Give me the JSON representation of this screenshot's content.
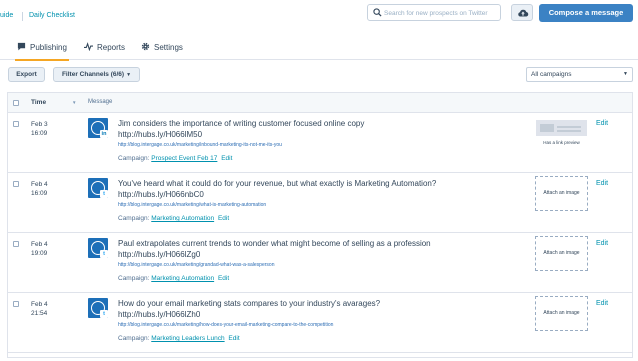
{
  "topbar": {
    "guide_link": "uide",
    "checklist_link": "Daily Checklist",
    "search_placeholder": "Search for new prospects on Twitter",
    "compose_label": "Compose a message",
    "icons": {
      "search": "search-icon",
      "cloud": "cloud-upload-icon"
    }
  },
  "tabs": [
    {
      "label": "Publishing",
      "icon": "speech-bubble-icon",
      "active": true
    },
    {
      "label": "Reports",
      "icon": "pulse-chart-icon",
      "active": false
    },
    {
      "label": "Settings",
      "icon": "gear-icon",
      "active": false
    }
  ],
  "toolbar": {
    "export_label": "Export",
    "filter_label": "Filter Channels (6/6)",
    "campaign_select_value": "All campaigns"
  },
  "table": {
    "headers": {
      "time": "Time",
      "message": "Message"
    },
    "rows": [
      {
        "date": "Feb 3",
        "time": "16:09",
        "network": "in",
        "message": "Jim considers the importance of writing customer focused online copy",
        "short_link": "http://hubs.ly/H066lM50",
        "full_link": "http://blog.intergage.co.uk/marketing/inbound-marketing-its-not-me-its-you",
        "campaign_label": "Campaign:",
        "campaign_name": "Prospect Event Feb 17",
        "campaign_edit": "Edit",
        "media_caption": "Has a link preview",
        "edit": "Edit"
      },
      {
        "date": "Feb 4",
        "time": "16:09",
        "network": "t",
        "message": "You've heard what it could do for your revenue, but what exactly is Marketing Automation?",
        "short_link": "http://hubs.ly/H066nbC0",
        "full_link": "http://blog.intergage.co.uk/marketing/what-is-marketing-automation",
        "campaign_label": "Campaign:",
        "campaign_name": "Marketing Automation",
        "campaign_edit": "Edit",
        "media_caption": "Attach an image",
        "edit": "Edit"
      },
      {
        "date": "Feb 4",
        "time": "19:09",
        "network": "t",
        "message": "Paul extrapolates current trends to wonder what might become of selling as a profession",
        "short_link": "http://hubs.ly/H066lZg0",
        "full_link": "http://blog.intergage.co.uk/marketing/grandad-what-was-a-salesperson",
        "campaign_label": "Campaign:",
        "campaign_name": "Marketing Automation",
        "campaign_edit": "Edit",
        "media_caption": "Attach an image",
        "edit": "Edit"
      },
      {
        "date": "Feb 4",
        "time": "21:54",
        "network": "t",
        "message": "How do your email marketing stats compares to your industry's avarages?",
        "short_link": "http://hubs.ly/H066lZh0",
        "full_link": "http://blog.intergage.co.uk/marketing/how-does-your-email-marketing-compare-to-the-competition",
        "campaign_label": "Campaign:",
        "campaign_name": "Marketing Leaders Lunch",
        "campaign_edit": "Edit",
        "media_caption": "Attach an image",
        "edit": "Edit"
      }
    ]
  },
  "colors": {
    "primary_button": "#3b82c4",
    "link": "#0091ae",
    "active_tab_underline": "#f5a623",
    "avatar_bg": "#1d6fb8"
  }
}
